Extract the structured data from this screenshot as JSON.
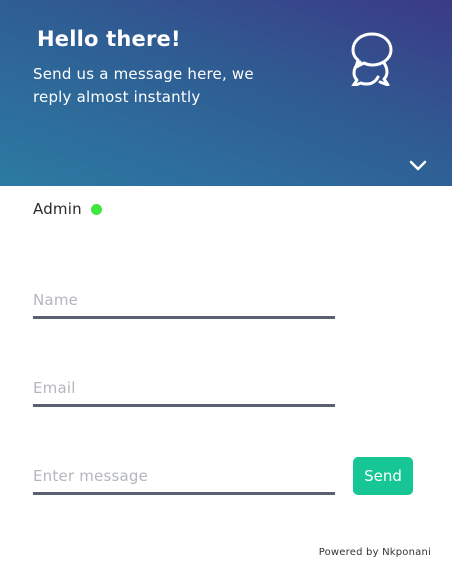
{
  "header": {
    "title": "Hello there!",
    "subtitle": "Send us a message here, we reply almost instantly",
    "icon": "chat-bubbles-icon",
    "collapse_icon": "chevron-down-icon",
    "gradient_colors": [
      "#3b3a86",
      "#2f5d93",
      "#2c7ba3"
    ]
  },
  "agent": {
    "name": "Admin",
    "status_color": "#3ee63e"
  },
  "form": {
    "name_placeholder": "Name",
    "email_placeholder": "Email",
    "message_placeholder": "Enter message",
    "send_label": "Send",
    "send_color": "#16c795"
  },
  "footer": {
    "powered_by": "Powered by Nkponani"
  }
}
